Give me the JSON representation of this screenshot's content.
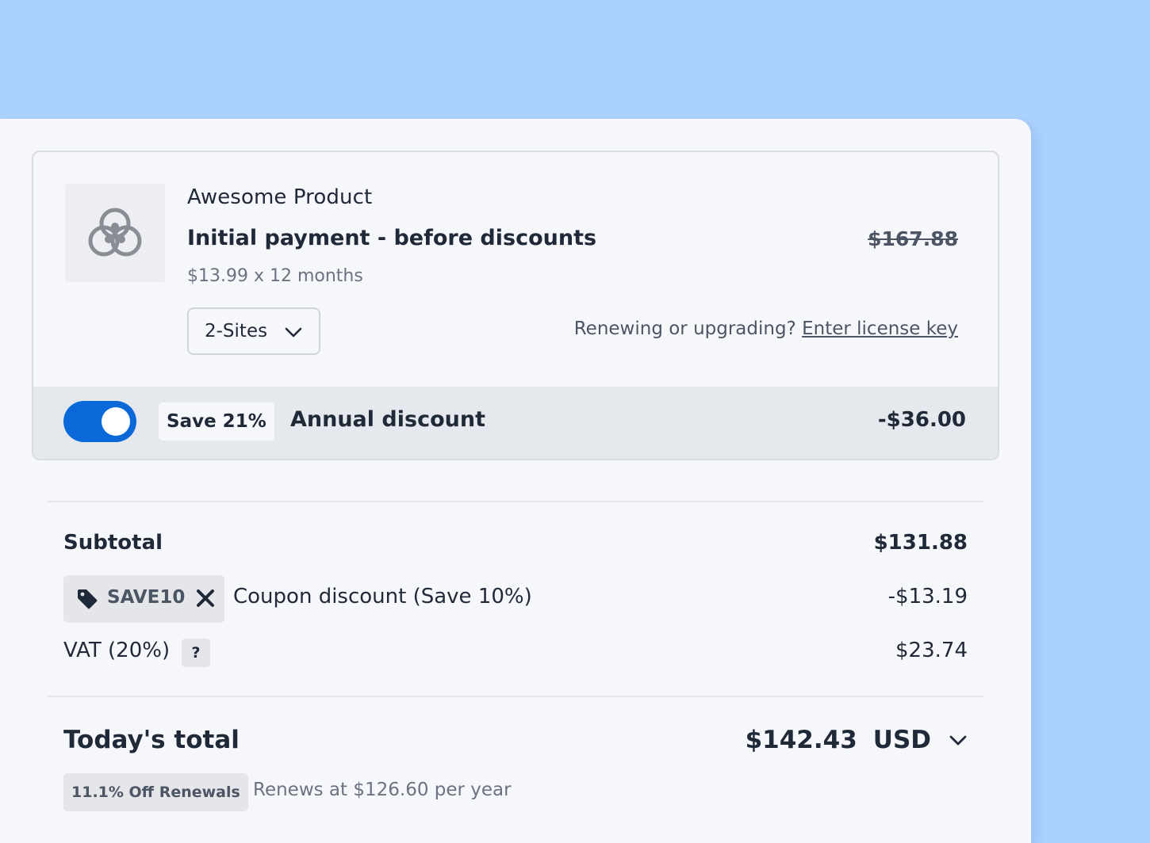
{
  "product": {
    "name": "Awesome Product",
    "plan_title": "Initial payment - before discounts",
    "original_price": "$167.88",
    "rate": "$13.99 x 12 months",
    "sites_selected": "2-Sites",
    "renew_prompt": "Renewing or upgrading?",
    "license_link": "Enter license key",
    "icon": "product-logo-icon"
  },
  "annual_discount": {
    "enabled": true,
    "badge": "Save 21%",
    "label": "Annual discount",
    "amount": "-$36.00"
  },
  "summary": {
    "subtotal_label": "Subtotal",
    "subtotal_value": "$131.88",
    "coupon_code": "SAVE10",
    "coupon_label": "Coupon discount (Save 10%)",
    "coupon_value": "-$13.19",
    "vat_label": "VAT (20%)",
    "vat_help": "?",
    "vat_value": "$23.74",
    "total_label": "Today's total",
    "total_value": "$142.43",
    "currency": "USD",
    "renewal_badge": "11.1% Off Renewals",
    "renewal_text": "Renews at $126.60 per year"
  },
  "colors": {
    "background": "#abd1fe",
    "panel": "#f6f7fb",
    "accent": "#0b68d8",
    "text": "#1f2937",
    "muted": "#6b7280"
  }
}
